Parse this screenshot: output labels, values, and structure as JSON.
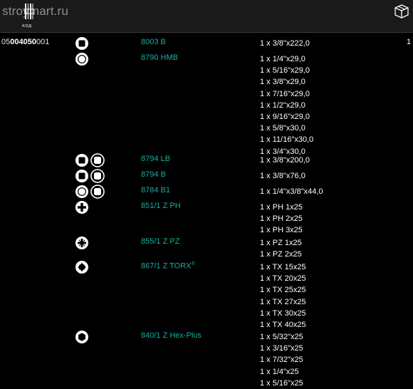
{
  "header": {
    "watermark": "stroymart.ru",
    "code_label": "код",
    "code_icon": "barcode-icon",
    "box_icon": "box-icon"
  },
  "colors": {
    "model": "#14b0a0",
    "background": "#000000",
    "header": "#1a1a1a"
  },
  "rows": [
    {
      "code_prefix": "05",
      "code_bold": "004050",
      "code_suffix": "001",
      "symbols": [
        "square-drive"
      ],
      "model": "8003 B",
      "model_mark": "",
      "specs": [
        "1 x 3/8\"x222,0"
      ],
      "qty": "1"
    },
    {
      "code_prefix": "",
      "code_bold": "",
      "code_suffix": "",
      "symbols": [
        "round-hex-drive"
      ],
      "model": "8790 HMB",
      "model_mark": "",
      "specs": [
        "1 x 1/4\"x29,0",
        "1 x 5/16\"x29,0",
        "1 x 3/8\"x29,0",
        "1 x 7/16\"x29,0",
        "1 x 1/2\"x29,0",
        "1 x 9/16\"x29,0",
        "1 x 5/8\"x30,0",
        "1 x 11/16\"x30,0",
        "1 x 3/4\"x30,0"
      ],
      "qty": ""
    },
    {
      "code_prefix": "",
      "code_bold": "",
      "code_suffix": "",
      "symbols": [
        "square-drive",
        "square-drive-outline"
      ],
      "model": "8794 LB",
      "model_mark": "",
      "specs": [
        "1 x 3/8\"x200,0"
      ],
      "qty": ""
    },
    {
      "code_prefix": "",
      "code_bold": "",
      "code_suffix": "",
      "symbols": [
        "square-drive",
        "square-drive-outline"
      ],
      "model": "8794 B",
      "model_mark": "",
      "specs": [
        "1 x 3/8\"x76,0"
      ],
      "qty": ""
    },
    {
      "code_prefix": "",
      "code_bold": "",
      "code_suffix": "",
      "symbols": [
        "round-hex-drive",
        "square-drive-outline"
      ],
      "model": "8784 B1",
      "model_mark": "",
      "specs": [
        "1 x 1/4\"x3/8\"x44,0"
      ],
      "qty": ""
    },
    {
      "code_prefix": "",
      "code_bold": "",
      "code_suffix": "",
      "symbols": [
        "phillips"
      ],
      "model": "851/1 Z PH",
      "model_mark": "",
      "specs": [
        "1 x PH 1x25",
        "1 x PH 2x25",
        "1 x PH 3x25"
      ],
      "qty": ""
    },
    {
      "code_prefix": "",
      "code_bold": "",
      "code_suffix": "",
      "symbols": [
        "pozidriv"
      ],
      "model": "855/1 Z PZ",
      "model_mark": "",
      "specs": [
        "1 x PZ 1x25",
        "1 x PZ 2x25"
      ],
      "qty": ""
    },
    {
      "code_prefix": "",
      "code_bold": "",
      "code_suffix": "",
      "symbols": [
        "torx"
      ],
      "model": "867/1 Z TORX",
      "model_mark": "®",
      "specs": [
        "1 x TX 15x25",
        "1 x TX 20x25",
        "1 x TX 25x25",
        "1 x TX 27x25",
        "1 x TX 30x25",
        "1 x TX 40x25"
      ],
      "qty": ""
    },
    {
      "code_prefix": "",
      "code_bold": "",
      "code_suffix": "",
      "symbols": [
        "hex"
      ],
      "model": "840/1 Z Hex-Plus",
      "model_mark": "",
      "specs": [
        "1 x 5/32\"x25",
        "1 x 3/16\"x25",
        "1 x 7/32\"x25",
        "1 x 1/4\"x25",
        "1 x 5/16\"x25"
      ],
      "qty": ""
    }
  ]
}
